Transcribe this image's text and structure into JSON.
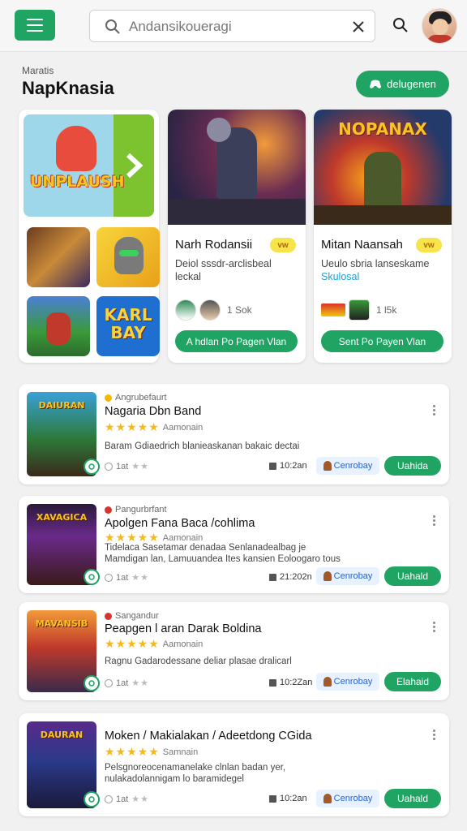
{
  "search": {
    "placeholder": "Andansikoueragi"
  },
  "section": {
    "subtitle": "Maratis",
    "title": "NapKnasia",
    "action_label": "delugenen"
  },
  "collection": {
    "hero_logo": "UNPLAUSH",
    "minis": [
      "",
      "",
      "",
      "KARL BAY"
    ]
  },
  "featured": [
    {
      "title": "Narh Rodansii",
      "badge": "vw",
      "desc": "Deiol sssdr-arclisbeal leckal",
      "desc_link": "",
      "count": "1 Sok",
      "button": "A hdlan Po Pagen Vlan",
      "art_label": ""
    },
    {
      "title": "Mitan Naansah",
      "badge": "vw",
      "desc": "Ueulo sbria lanseskame",
      "desc_link": "Skulosal",
      "count": "1 l5k",
      "button": "Sent Po Payen Vlan",
      "art_label": "NOPANAX"
    }
  ],
  "rows": [
    {
      "category": "Angrubefaurt",
      "cat_color": "#f5b800",
      "title": "Nagaria Dbn Band",
      "rating_text": "Aamonain",
      "desc": "Baram Gdiaedrich blanieaskanan bakaic dectai",
      "foot": "1at",
      "time": "10:2an",
      "tag": "Cenrobay",
      "button": "Uahida",
      "thumb_label": "DAIURAN"
    },
    {
      "category": "Pangurbrfant",
      "cat_color": "#d9342b",
      "title": "Apolgen Fana Baca /cohlima",
      "rating_text": "Aamonain",
      "desc": "Tidelaca Sasetamar denadaa Senlanadealbag je Mamdigan lan, Lamuuandea Ites kansien Eoloogaro tous",
      "foot": "1at",
      "time": "21:202n",
      "tag": "Cenrobay",
      "button": "Uahald",
      "thumb_label": "XAVAGICA"
    },
    {
      "category": "Sangandur",
      "cat_color": "#d9342b",
      "title": "Peapgen l aran Darak Boldina",
      "rating_text": "Aamonain",
      "desc": "Ragnu Gadarodessane deliar plasae dralicarl",
      "foot": "1at",
      "time": "10:2Zan",
      "tag": "Cenrobay",
      "button": "Elahaid",
      "thumb_label": "MAVANSIB"
    },
    {
      "category": "",
      "cat_color": "#d9342b",
      "title": "Moken / Makialakan / Adeetdong CGida",
      "rating_text": "Samnain",
      "desc": "Pelsgnoreocenamanelake clnlan badan yer, nulakadolannigam lo baramidegel",
      "foot": "1at",
      "time": "10:2an",
      "tag": "Cenrobay",
      "button": "Uahald",
      "thumb_label": "DAURAN"
    }
  ],
  "colors": {
    "accent": "#1fa463",
    "star": "#f6b91a",
    "tag_text": "#2964c9"
  }
}
